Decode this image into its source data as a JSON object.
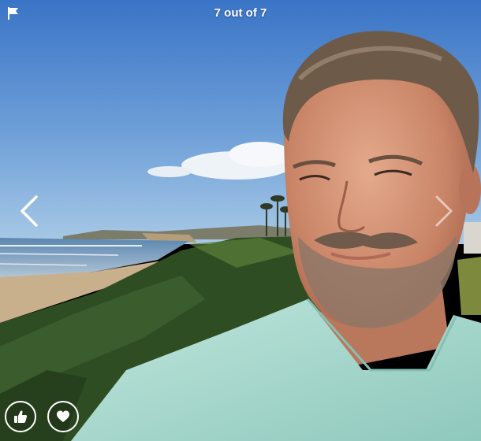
{
  "viewer": {
    "counter_text": "7 out of 7"
  },
  "icons": {
    "flag": "flag-icon",
    "prev": "chevron-left-icon",
    "next": "chevron-right-icon",
    "like": "thumbs-up-icon",
    "favorite": "heart-icon"
  },
  "colors": {
    "sky_top": "#3c77c8",
    "sky_bottom": "#9cc3e4",
    "foliage": "#2f4f24",
    "shirt": "#a9d8cf",
    "icon_white": "#ffffff"
  }
}
